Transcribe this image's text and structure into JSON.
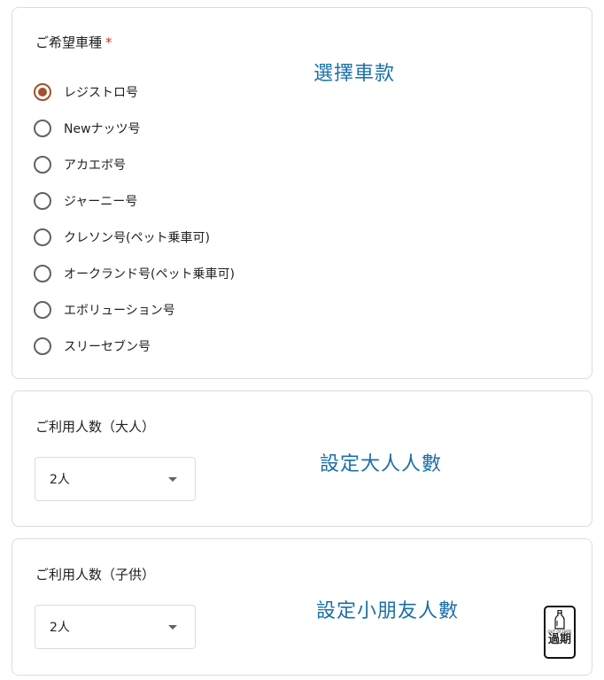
{
  "vehicle": {
    "title": "ご希望車種",
    "required_mark": "*",
    "annotation": "選擇車款",
    "options": [
      {
        "label": "レジストロ号",
        "selected": true
      },
      {
        "label": "Newナッツ号",
        "selected": false
      },
      {
        "label": "アカエボ号",
        "selected": false
      },
      {
        "label": "ジャーニー号",
        "selected": false
      },
      {
        "label": "クレソン号(ペット乗車可)",
        "selected": false
      },
      {
        "label": "オークランド号(ペット乗車可)",
        "selected": false
      },
      {
        "label": "エボリューション号",
        "selected": false
      },
      {
        "label": "スリーセブン号",
        "selected": false
      }
    ],
    "radio_accent_color": "#a0522d"
  },
  "adults": {
    "title": "ご利用人数（大人）",
    "annotation": "設定大人人數",
    "selected_value": "2人"
  },
  "children": {
    "title": "ご利用人数（子供）",
    "annotation": "設定小朋友人數",
    "selected_value": "2人"
  },
  "stamp": {
    "small_text": "OUT OF DATE",
    "big_text": "過期",
    "icon": "bottle-icon"
  },
  "colors": {
    "annotation": "#1a6fa8",
    "border": "#dadce0",
    "required": "#d93025"
  }
}
